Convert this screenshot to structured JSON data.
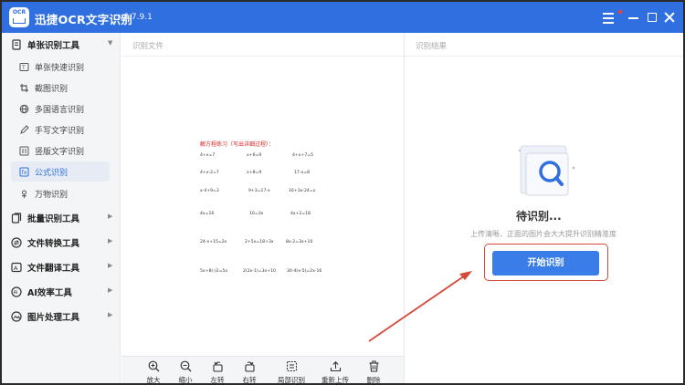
{
  "titlebar": {
    "logo_text": "OCR",
    "app_name": "迅捷OCR文字识别",
    "version": "v8.7.9.1"
  },
  "sidebar": {
    "group_single": {
      "label": "单张识别工具",
      "items": [
        {
          "label": "单张快速识别"
        },
        {
          "label": "截图识别"
        },
        {
          "label": "多国语言识别"
        },
        {
          "label": "手写文字识别"
        },
        {
          "label": "竖版文字识别"
        },
        {
          "label": "公式识别"
        },
        {
          "label": "万物识别"
        }
      ],
      "active_index": 5
    },
    "groups": [
      {
        "label": "批量识别工具"
      },
      {
        "label": "文件转换工具"
      },
      {
        "label": "文件翻译工具"
      },
      {
        "label": "AI效率工具"
      },
      {
        "label": "图片处理工具"
      }
    ]
  },
  "left_panel": {
    "header": "识别文件",
    "document": {
      "title": "解方程练习（写出详细过程）：",
      "rows": [
        [
          "4+x=7",
          "x+6=9",
          "4+x+7=5"
        ],
        [
          "4+x-2=7",
          "x+8=9",
          "17-x=8"
        ],
        [
          "x-4+9=3",
          "9+3=17-x",
          "16+3x-24=x"
        ],
        [
          "4x=16",
          "10=3x",
          "4x+2=18"
        ],
        [
          "24-x+15=2x",
          "2+5x=18+3x",
          "8x-2=3x+10"
        ],
        [
          "5x+8(-)2=5x",
          "2(2x-1)=3x+10",
          "30-4(x-5)=2x-16"
        ]
      ]
    },
    "toolbar": [
      {
        "label": "放大",
        "icon": "zoom-in-icon"
      },
      {
        "label": "缩小",
        "icon": "zoom-out-icon"
      },
      {
        "label": "左转",
        "icon": "rotate-left-icon"
      },
      {
        "label": "右转",
        "icon": "rotate-right-icon"
      },
      {
        "label": "局部识别",
        "icon": "partial-recognize-icon"
      },
      {
        "label": "重新上传",
        "icon": "upload-icon"
      },
      {
        "label": "删除",
        "icon": "delete-icon"
      }
    ]
  },
  "right_panel": {
    "header": "识别结果",
    "status": "待识别...",
    "hint": "上传清晰、正面的图片会大大提升识别精准度",
    "start_button": "开始识别"
  },
  "colors": {
    "brand": "#2f6fe0",
    "button": "#3a7ce8",
    "annotation": "#d64a3a",
    "doc_title": "#d42020"
  }
}
